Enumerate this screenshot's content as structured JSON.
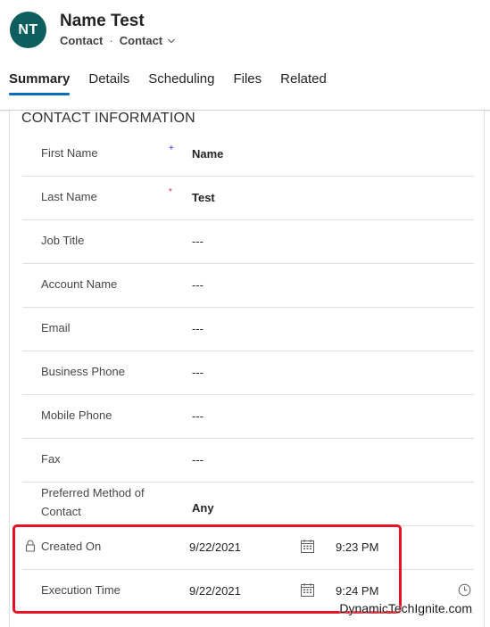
{
  "record": {
    "initials": "NT",
    "name": "Name Test",
    "entity": "Contact",
    "separator": "·",
    "form": "Contact",
    "avatar_color": "#0e5e5e"
  },
  "tabs": [
    {
      "label": "Summary",
      "active": true
    },
    {
      "label": "Details",
      "active": false
    },
    {
      "label": "Scheduling",
      "active": false
    },
    {
      "label": "Files",
      "active": false
    },
    {
      "label": "Related",
      "active": false
    }
  ],
  "section": {
    "title": "CONTACT INFORMATION",
    "fields": [
      {
        "label": "First Name",
        "value": "Name",
        "required": "+"
      },
      {
        "label": "Last Name",
        "value": "Test",
        "required": "*"
      },
      {
        "label": "Job Title",
        "value": "---"
      },
      {
        "label": "Account Name",
        "value": "---"
      },
      {
        "label": "Email",
        "value": "---"
      },
      {
        "label": "Business Phone",
        "value": "---"
      },
      {
        "label": "Mobile Phone",
        "value": "---"
      },
      {
        "label": "Fax",
        "value": "---"
      },
      {
        "label": "Preferred Method of Contact",
        "value": "Any"
      },
      {
        "label": "Created On",
        "date": "9/22/2021",
        "time": "9:23 PM",
        "locked": true
      },
      {
        "label": "Execution Time",
        "date": "9/22/2021",
        "time": "9:24 PM"
      }
    ]
  },
  "watermark": "DynamicTechIgnite.com",
  "colors": {
    "accent": "#0f6cbd",
    "highlight": "#e81123",
    "required_red": "#c4314b",
    "recommended_blue": "#2b2bd6"
  }
}
